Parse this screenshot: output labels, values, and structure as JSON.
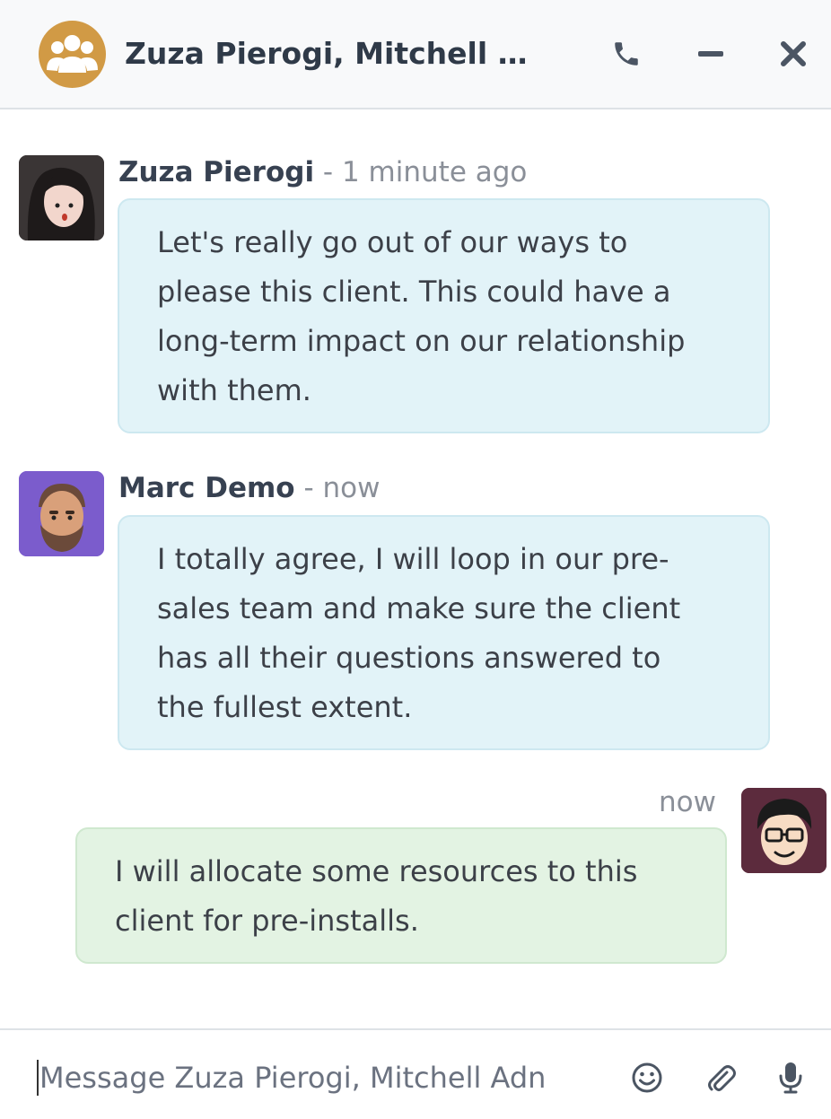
{
  "header": {
    "title": "Zuza Pierogi, Mitchell Ad...",
    "icons": {
      "group": "group-icon",
      "call": "phone-icon",
      "minimize": "minimize-icon",
      "close": "close-icon"
    },
    "accent_color": "#d19a45"
  },
  "messages": [
    {
      "author": "Zuza Pierogi",
      "separator": " - ",
      "time": "1 minute ago",
      "lines": [
        "Let's really go out of our ways to",
        "please this client. This could have a",
        "long-term impact on our relationship",
        "with them."
      ]
    },
    {
      "author": "Marc Demo",
      "separator": " - ",
      "time": "now",
      "lines": [
        "I totally agree, I will loop in our pre-",
        "sales team and make sure the client",
        "has all their questions answered to",
        "the fullest extent."
      ]
    },
    {
      "author": "",
      "time": "now",
      "lines": [
        "I will allocate some resources to this",
        "client for pre-installs."
      ]
    }
  ],
  "composer": {
    "placeholder": "Message Zuza Pierogi, Mitchell Adn",
    "value": "",
    "icons": {
      "emoji": "emoji-icon",
      "attach": "paperclip-icon",
      "voice": "microphone-icon"
    }
  },
  "colors": {
    "incoming_bubble": "#e2f3f8",
    "outgoing_bubble": "#e3f3e3"
  }
}
